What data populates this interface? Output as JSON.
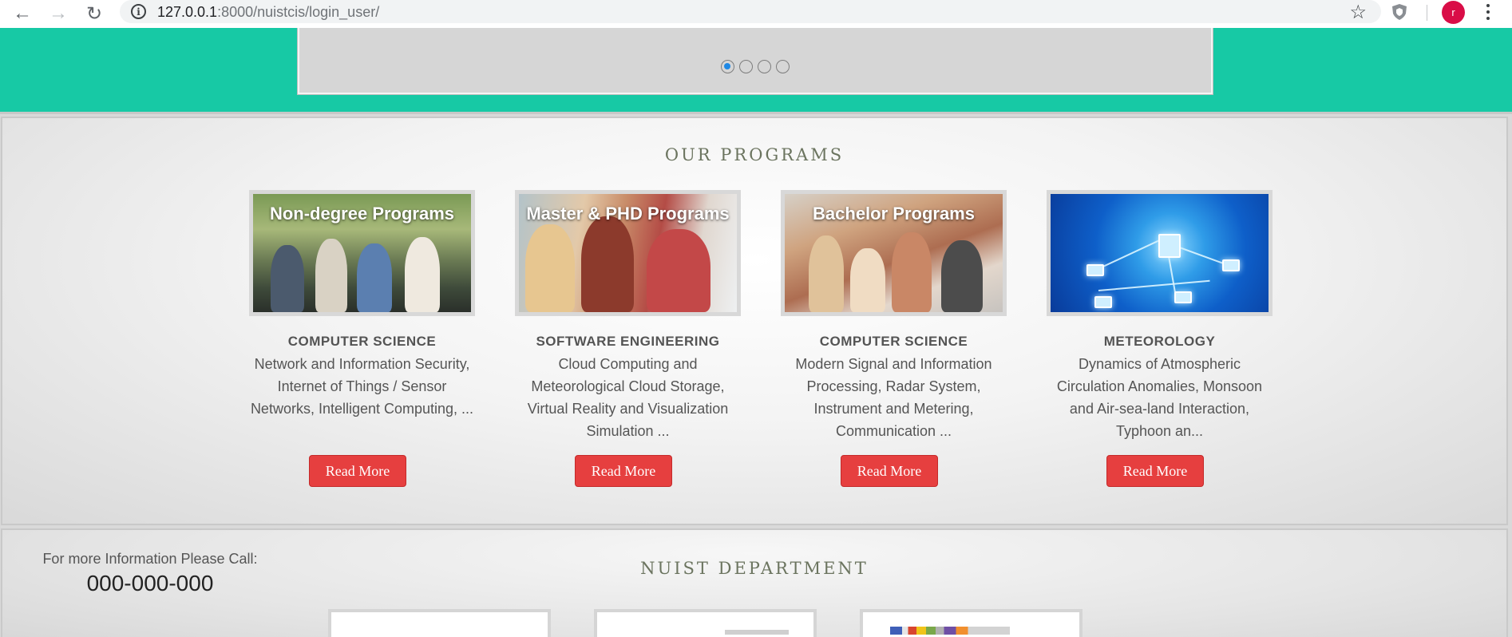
{
  "browser": {
    "url_host": "127.0.0.1",
    "url_rest": ":8000/nuistcis/login_user/",
    "avatar_letter": "r",
    "avatar_color": "#d90d47"
  },
  "hero": {
    "accent_color": "#17c9a5",
    "slider_dots": 4,
    "active_dot": 1
  },
  "programs": {
    "title": "OUR PROGRAMS",
    "items": [
      {
        "image_caption": "Non-degree Programs",
        "title": "COMPUTER SCIENCE",
        "description": "Network and Information Security, Internet of Things / Sensor Networks, Intelligent Computing, ...",
        "button": "Read More"
      },
      {
        "image_caption": "Master & PHD Programs",
        "title": "SOFTWARE ENGINEERING",
        "description": "Cloud Computing and Meteorological Cloud Storage, Virtual Reality and Visualization Simulation ...",
        "button": "Read More"
      },
      {
        "image_caption": "Bachelor Programs",
        "title": "COMPUTER SCIENCE",
        "description": "Modern Signal and Information Processing, Radar System, Instrument and Metering, Communication ...",
        "button": "Read More"
      },
      {
        "image_caption": "",
        "title": "METEOROLOGY",
        "description": "Dynamics of Atmospheric Circulation Anomalies, Monsoon and Air-sea-land Interaction, Typhoon an...",
        "button": "Read More"
      }
    ],
    "button_color": "#e63f3f"
  },
  "department": {
    "title": "NUIST DEPARTMENT",
    "contact_line": "For more Information Please Call:",
    "phone": "000-000-000"
  }
}
